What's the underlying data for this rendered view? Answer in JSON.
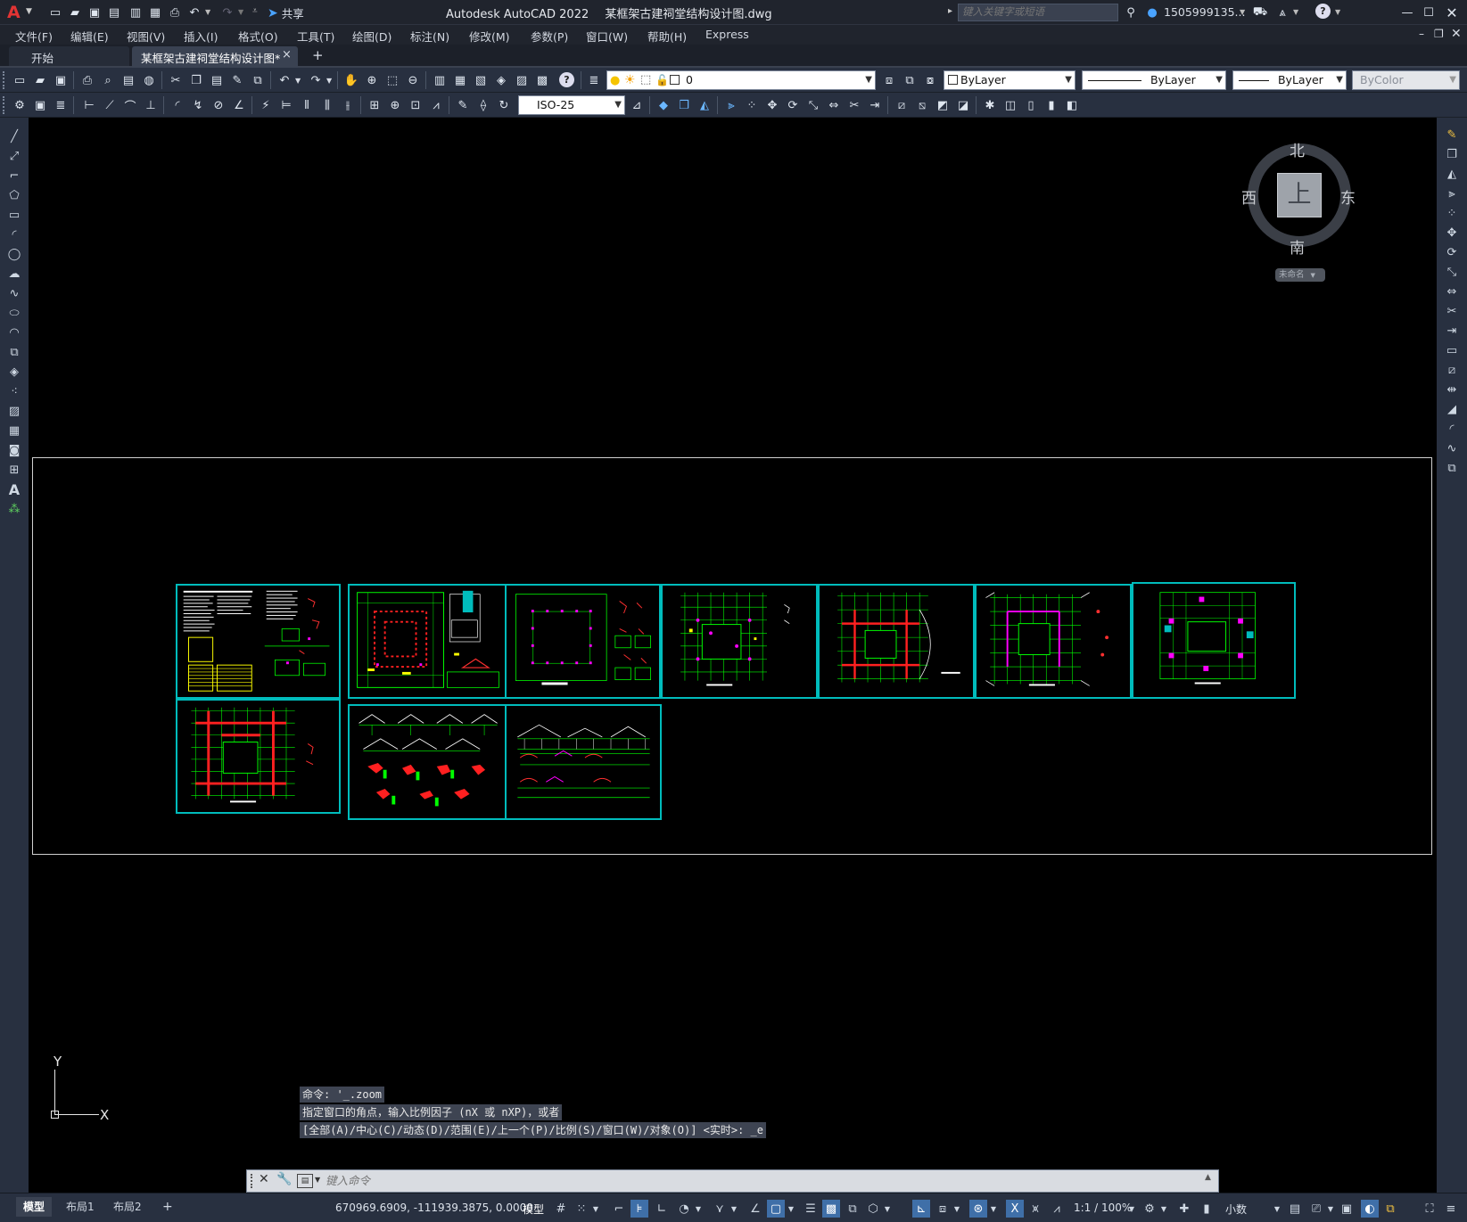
{
  "titlebar": {
    "app_logo": "A",
    "share_label": "共享",
    "app_title": "Autodesk AutoCAD 2022",
    "file_name": "某框架古建祠堂结构设计图.dwg",
    "search_placeholder": "键入关键字或短语",
    "user_name": "1505999135...",
    "icons": [
      "new-icon",
      "open-icon",
      "save-icon",
      "save-as-icon",
      "publish-icon",
      "plot-icon",
      "print-icon",
      "undo-icon",
      "redo-icon",
      "share-icon",
      "search-icon",
      "user-icon",
      "cart-icon",
      "learn-icon",
      "help-icon",
      "minimize-icon",
      "maximize-icon",
      "close-icon"
    ]
  },
  "menu": {
    "items": [
      "文件(F)",
      "编辑(E)",
      "视图(V)",
      "插入(I)",
      "格式(O)",
      "工具(T)",
      "绘图(D)",
      "标注(N)",
      "修改(M)",
      "参数(P)",
      "窗口(W)",
      "帮助(H)",
      "Express"
    ]
  },
  "tabs": {
    "start": "开始",
    "active": "某框架古建祠堂结构设计图*",
    "close": "×",
    "add": "+"
  },
  "toolbar1": {
    "layer_value": "0",
    "color_value": "ByLayer",
    "linetype_value": "ByLayer",
    "lineweight_value": "ByLayer",
    "plotstyle_value": "ByColor"
  },
  "toolbar2": {
    "dimstyle_value": "ISO-25"
  },
  "viewcube": {
    "north": "北",
    "south": "南",
    "east": "东",
    "west": "西",
    "face": "上",
    "ucs_label": "未命名"
  },
  "ucs_icon": {
    "y": "Y",
    "x": "X"
  },
  "command": {
    "history": [
      "命令: '_.zoom",
      "指定窗口的角点，输入比例因子 (nX 或 nXP)，或者",
      "[全部(A)/中心(C)/动态(D)/范围(E)/上一个(P)/比例(S)/窗口(W)/对象(O)] <实时>: _e"
    ],
    "placeholder": "键入命令"
  },
  "layout_tabs": [
    "模型",
    "布局1",
    "布局2"
  ],
  "layout_add": "+",
  "status": {
    "coords": "670969.6909, -111939.3875, 0.0000",
    "model_label": "模型",
    "annotation_scale": "1:1 / 100%",
    "units": "小数"
  },
  "colors": {
    "canvas": "#000000",
    "sheet_border": "#00bcbc",
    "drawing_green": "#00ff00",
    "drawing_red": "#ff2020",
    "drawing_magenta": "#ff00ff",
    "drawing_yellow": "#ffff00",
    "ui_dark": "#283040"
  }
}
